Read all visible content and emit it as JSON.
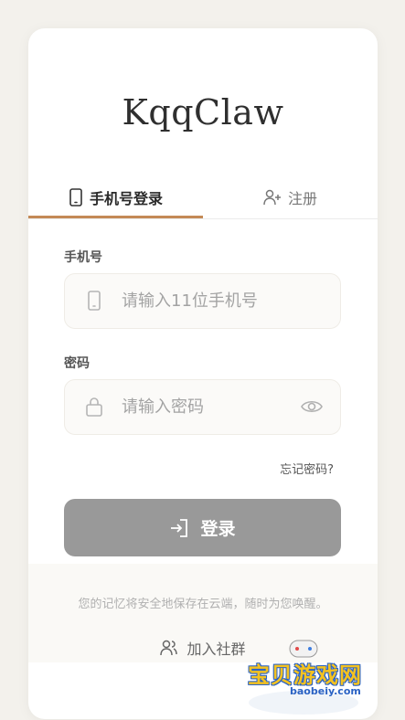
{
  "brand": {
    "title": "KqqClaw"
  },
  "tabs": {
    "login_label": "手机号登录",
    "register_label": "注册",
    "accent": "#c48a56"
  },
  "phone": {
    "label": "手机号",
    "placeholder": "请输入11位手机号",
    "value": ""
  },
  "password": {
    "label": "密码",
    "placeholder": "请输入密码",
    "value": ""
  },
  "forgot_label": "忘记密码?",
  "login_button": {
    "label": "登录",
    "color": "#999999"
  },
  "footer": {
    "note": "您的记忆将安全地保存在云端，随时为您唤醒。"
  },
  "community": {
    "label": "加入社群"
  },
  "watermark": {
    "text": "宝贝游戏网",
    "url": "baobeiy.com"
  }
}
